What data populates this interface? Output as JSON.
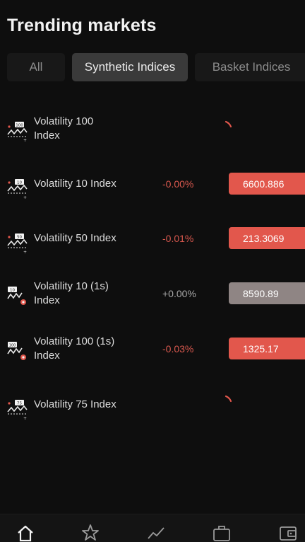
{
  "header": {
    "title": "Trending markets"
  },
  "tabs": [
    {
      "label": "All",
      "active": false
    },
    {
      "label": "Synthetic Indices",
      "active": true
    },
    {
      "label": "Basket Indices",
      "active": false
    }
  ],
  "markets": [
    {
      "name_line1": "Volatility 100",
      "name_line2": "Index",
      "icon_badge": "100",
      "change": "",
      "price": "",
      "loading": true
    },
    {
      "name_line1": "Volatility 10 Index",
      "name_line2": "",
      "icon_badge": "10",
      "change": "-0.00%",
      "price": "6600.886",
      "loading": false
    },
    {
      "name_line1": "Volatility 50 Index",
      "name_line2": "",
      "icon_badge": "50",
      "change": "-0.01%",
      "price": "213.3069",
      "loading": false
    },
    {
      "name_line1": "Volatility 10 (1s)",
      "name_line2": "Index",
      "icon_badge": "10",
      "change": "+0.00%",
      "price": "8590.89",
      "loading": false
    },
    {
      "name_line1": "Volatility 100 (1s)",
      "name_line2": "Index",
      "icon_badge": "100",
      "change": "-0.03%",
      "price": "1325.17",
      "loading": false
    },
    {
      "name_line1": "Volatility 75 Index",
      "name_line2": "",
      "icon_badge": "75",
      "change": "",
      "price": "",
      "loading": true
    }
  ],
  "bottom_nav": [
    {
      "icon": "home-icon",
      "active": true
    },
    {
      "icon": "star-icon",
      "active": false
    },
    {
      "icon": "trend-icon",
      "active": false
    },
    {
      "icon": "briefcase-icon",
      "active": false
    },
    {
      "icon": "wallet-icon",
      "active": false
    }
  ],
  "colors": {
    "negative": "#e2574c",
    "neutral": "#8f8584",
    "background": "#0e0e0e",
    "active_tab": "#3a3a3a"
  }
}
